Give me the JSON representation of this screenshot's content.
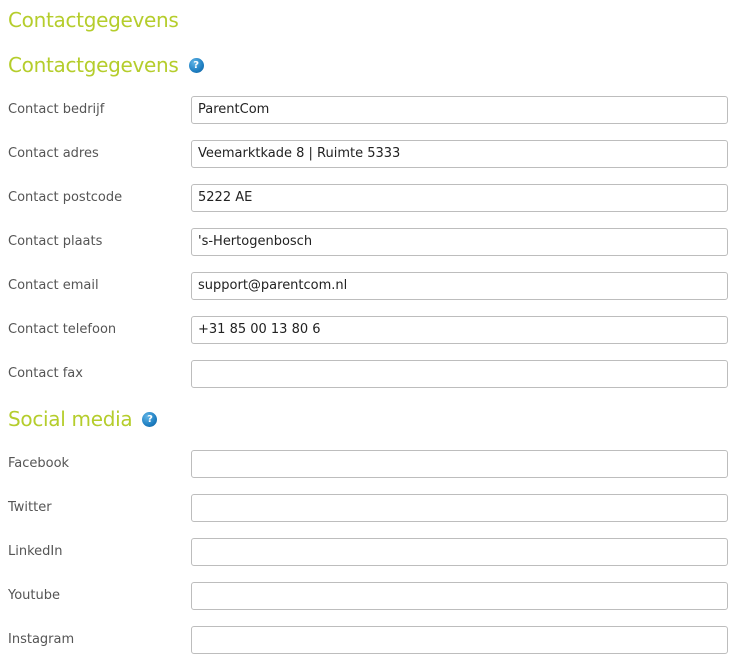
{
  "page_title": "Contactgegevens",
  "contact_section": {
    "title": "Contactgegevens",
    "help_icon": "question-mark-icon",
    "fields": [
      {
        "label": "Contact bedrijf",
        "value": "ParentCom"
      },
      {
        "label": "Contact adres",
        "value": "Veemarktkade 8 | Ruimte 5333"
      },
      {
        "label": "Contact postcode",
        "value": "5222 AE"
      },
      {
        "label": "Contact plaats",
        "value": "'s-Hertogenbosch"
      },
      {
        "label": "Contact email",
        "value": "support@parentcom.nl"
      },
      {
        "label": "Contact telefoon",
        "value": "+31 85 00 13 80 6"
      },
      {
        "label": "Contact fax",
        "value": ""
      }
    ]
  },
  "social_section": {
    "title": "Social media",
    "help_icon": "question-mark-icon",
    "fields": [
      {
        "label": "Facebook",
        "value": ""
      },
      {
        "label": "Twitter",
        "value": ""
      },
      {
        "label": "LinkedIn",
        "value": ""
      },
      {
        "label": "Youtube",
        "value": ""
      },
      {
        "label": "Instagram",
        "value": ""
      }
    ]
  },
  "colors": {
    "heading": "#b5cd2c",
    "help_icon": "#1f7fc2",
    "label": "#555555",
    "field_border": "#bdbdbd"
  }
}
